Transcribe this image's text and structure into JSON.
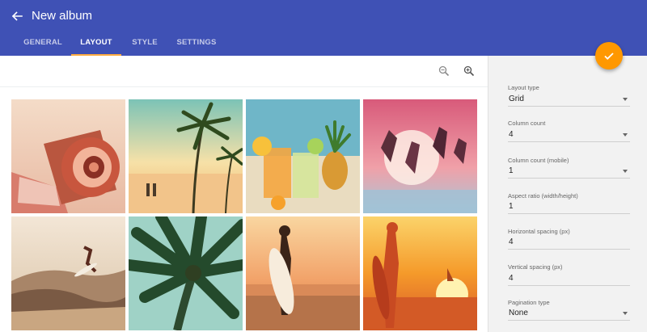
{
  "header": {
    "title": "New album",
    "tabs": [
      "GENERAL",
      "LAYOUT",
      "STYLE",
      "SETTINGS"
    ],
    "active_tab": "LAYOUT"
  },
  "toolbar": {
    "icons": [
      "zoom-out-icon",
      "zoom-in-icon"
    ]
  },
  "photos": [
    {
      "subject": "vintage camera"
    },
    {
      "subject": "palm beach couple"
    },
    {
      "subject": "tropical cocktails"
    },
    {
      "subject": "friends jumping in sea"
    },
    {
      "subject": "surfer on wave"
    },
    {
      "subject": "palm tree"
    },
    {
      "subject": "woman with surfboard"
    },
    {
      "subject": "surfer silhouette at sunset"
    }
  ],
  "layout_settings": [
    {
      "label": "Layout type",
      "value": "Grid",
      "dropdown": true
    },
    {
      "label": "Column count",
      "value": "4",
      "dropdown": true
    },
    {
      "label": "Column count (mobile)",
      "value": "1",
      "dropdown": true
    },
    {
      "label": "Aspect ratio (width/height)",
      "value": "1",
      "dropdown": false
    },
    {
      "label": "Horizontal spacing (px)",
      "value": "4",
      "dropdown": false
    },
    {
      "label": "Vertical spacing (px)",
      "value": "4",
      "dropdown": false
    },
    {
      "label": "Pagination type",
      "value": "None",
      "dropdown": true
    }
  ],
  "colors": {
    "primary": "#3f51b5",
    "accent": "#ff9800",
    "tab_indicator": "#ffab40"
  }
}
